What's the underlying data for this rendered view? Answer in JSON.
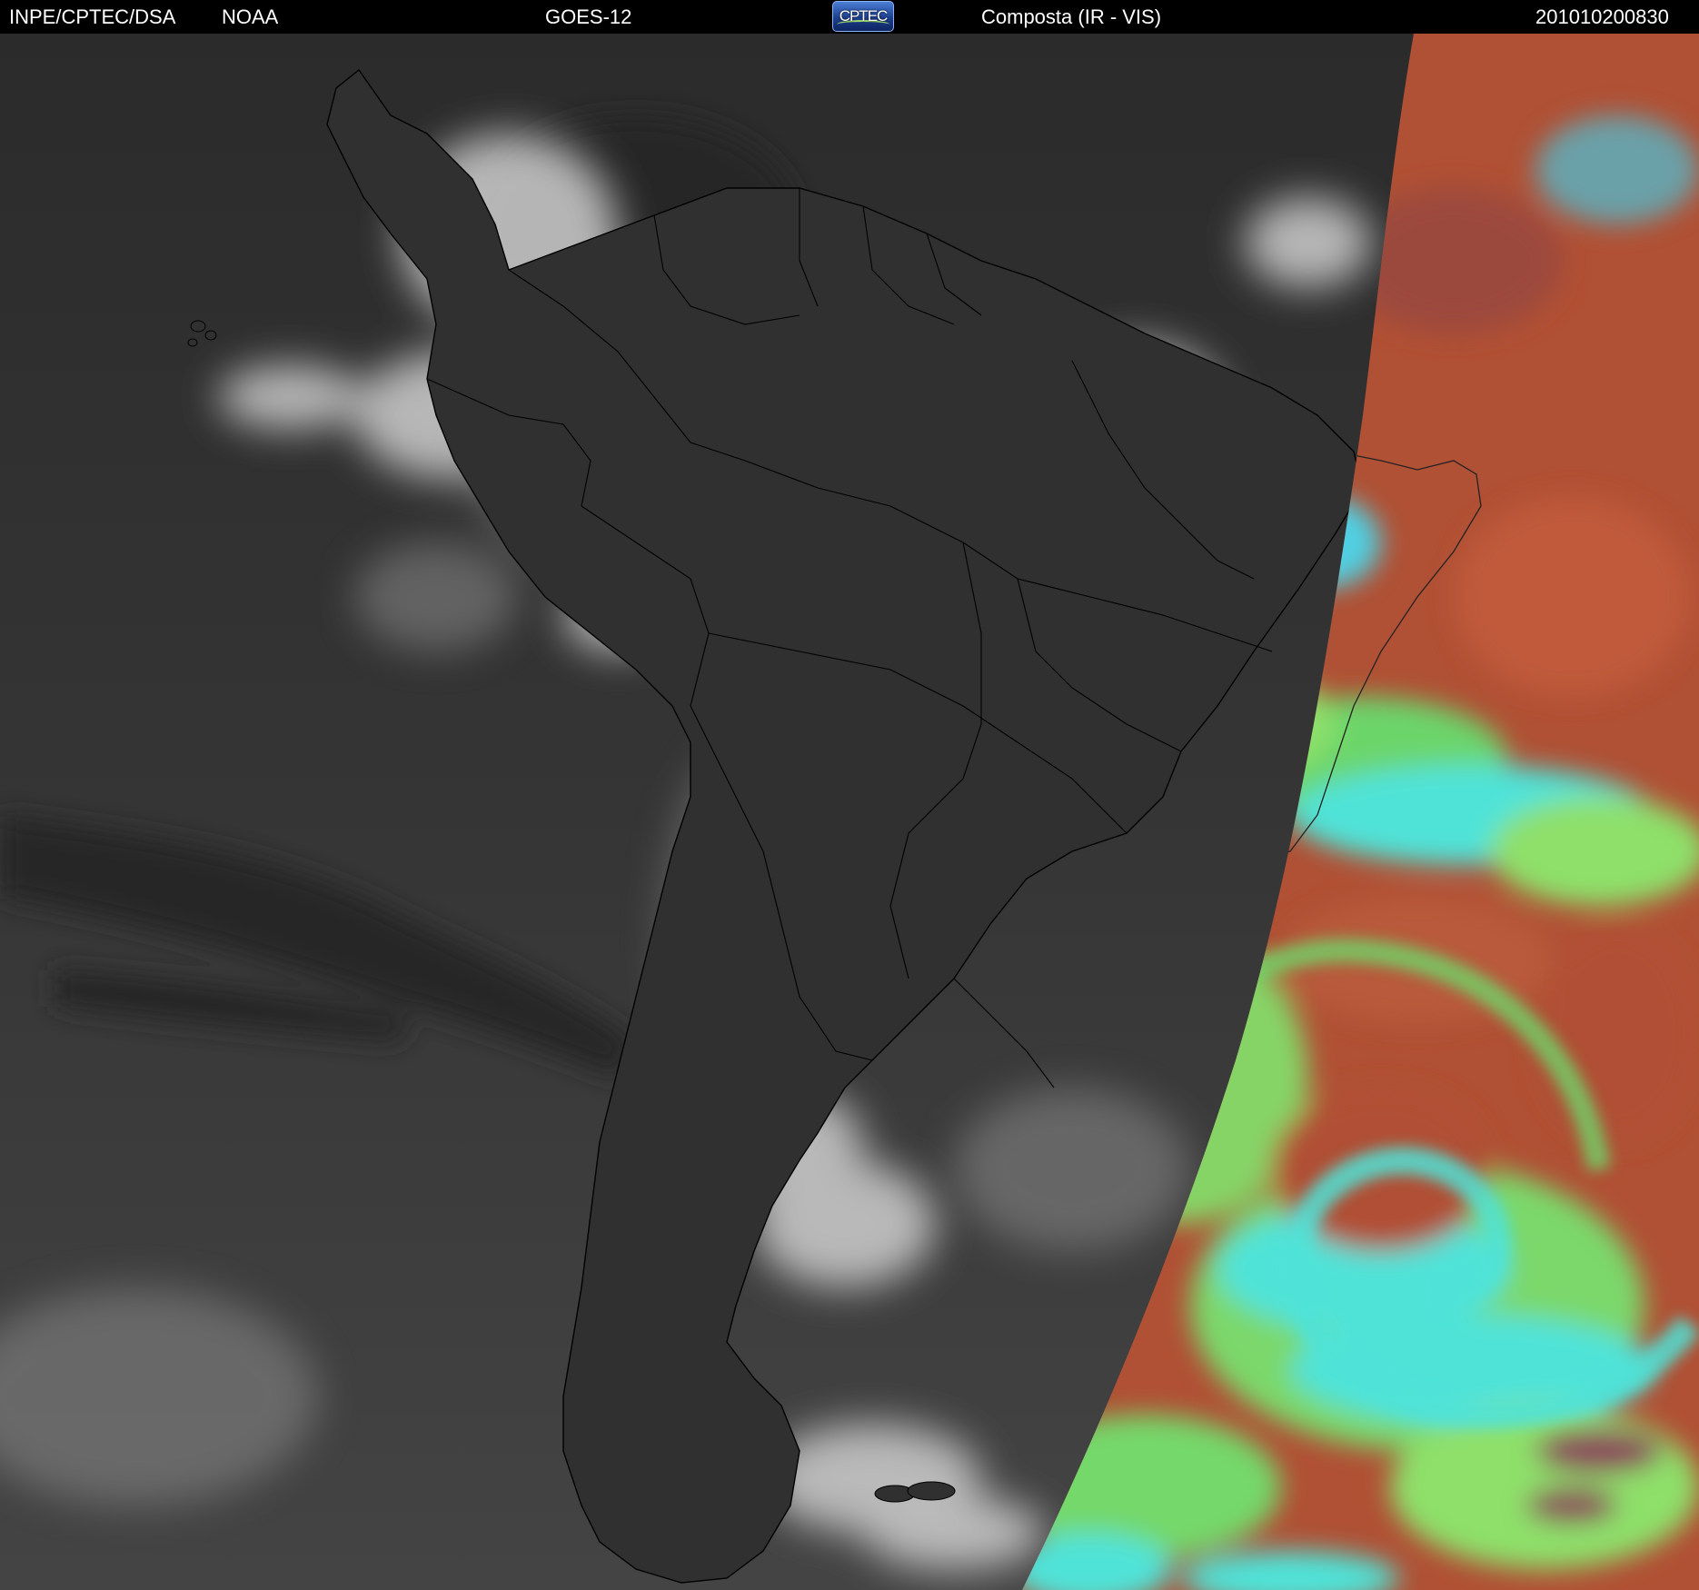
{
  "header": {
    "organization": "INPE/CPTEC/DSA",
    "agency": "NOAA",
    "satellite": "GOES-12",
    "logo_text": "CPTEC",
    "product": "Composta (IR - VIS)",
    "timestamp": "201010200830"
  },
  "map": {
    "region": "South America",
    "view": "satellite-composite",
    "night_side": "grayscale-infrared",
    "day_side": "false-color-visible",
    "colors": {
      "ocean_ir": "#3a3a3a",
      "cloud_ir": "#d8d8d8",
      "vis_ocean_red": "#b05034",
      "vis_cloud_green": "#8ee06a",
      "vis_cloud_cyan": "#4fe3d8",
      "coastline": "#000000"
    }
  }
}
